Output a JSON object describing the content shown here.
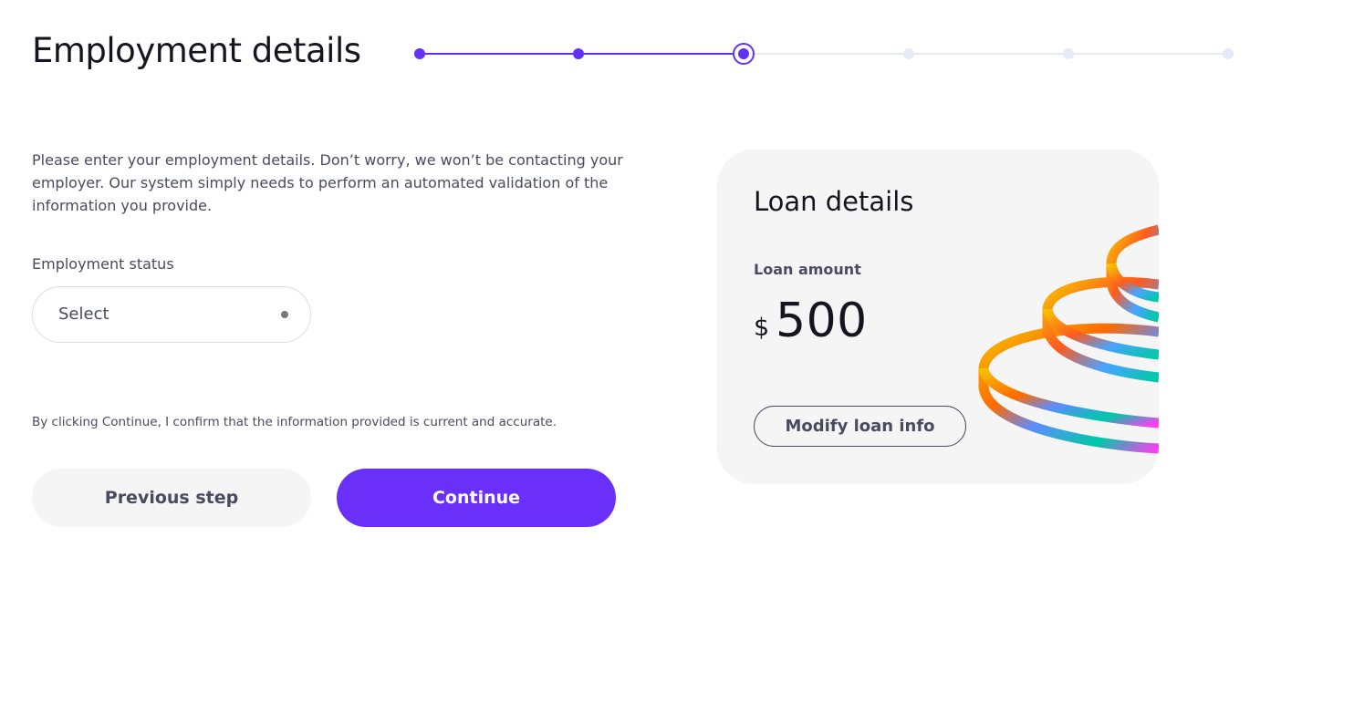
{
  "page": {
    "title": "Employment details"
  },
  "stepper": {
    "total_steps": 6,
    "current_step": 3,
    "accent_color": "#6332f6",
    "inactive_color": "#e5eaf7"
  },
  "form": {
    "intro": "Please enter your employment details. Don’t worry, we won’t be contacting your employer. Our system simply needs to perform an automated validation of the information you provide.",
    "employment_status": {
      "label": "Employment status",
      "value": "Select"
    },
    "consent": "By clicking Continue, I confirm that the information provided is current and accurate.",
    "previous_label": "Previous step",
    "continue_label": "Continue",
    "continue_color": "#6a2ff8"
  },
  "loan_card": {
    "title": "Loan details",
    "amount_label": "Loan amount",
    "currency": "$",
    "amount": "500",
    "modify_label": "Modify loan info",
    "illustration_icon": "stacked-rings-illustration"
  }
}
